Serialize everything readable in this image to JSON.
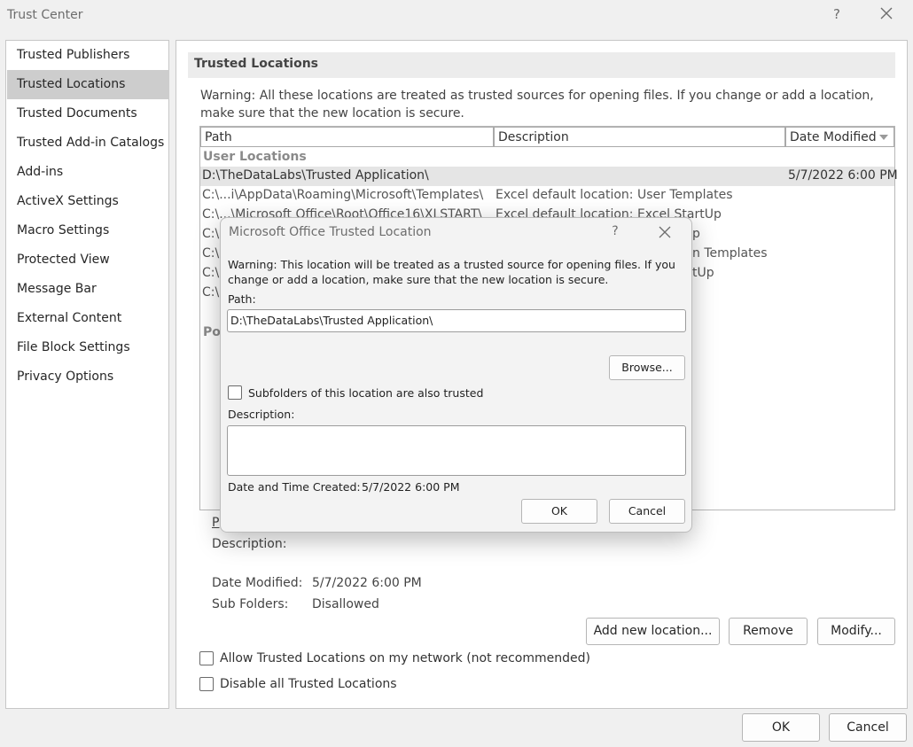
{
  "window": {
    "title": "Trust Center",
    "help": "?",
    "close_icon": "close-icon"
  },
  "sidebar": {
    "items": [
      {
        "label": "Trusted Publishers"
      },
      {
        "label": "Trusted Locations",
        "selected": true
      },
      {
        "label": "Trusted Documents"
      },
      {
        "label": "Trusted Add-in Catalogs"
      },
      {
        "label": "Add-ins"
      },
      {
        "label": "ActiveX Settings"
      },
      {
        "label": "Macro Settings"
      },
      {
        "label": "Protected View"
      },
      {
        "label": "Message Bar"
      },
      {
        "label": "External Content"
      },
      {
        "label": "File Block Settings"
      },
      {
        "label": "Privacy Options"
      }
    ]
  },
  "main": {
    "section_title": "Trusted Locations",
    "warning": "Warning: All these locations are treated as trusted sources for opening files.  If you change or add a location, make sure that the new location is secure.",
    "table": {
      "columns": [
        "Path",
        "Description",
        "Date Modified"
      ],
      "sort_icon": "sort-down-icon",
      "group_user": "User Locations",
      "group_policy_partial": "Po",
      "rows": [
        {
          "path": "D:\\TheDataLabs\\Trusted Application\\",
          "description": "",
          "date": "5/7/2022 6:00 PM",
          "selected": true
        },
        {
          "path": "C:\\...i\\AppData\\Roaming\\Microsoft\\Templates\\",
          "description": "Excel default location: User Templates",
          "date": ""
        },
        {
          "path": "C:\\...\\Microsoft Office\\Root\\Office16\\XLSTART\\",
          "description": "Excel default location: Excel StartUp",
          "date": ""
        },
        {
          "path": "C:\\.",
          "description": "p",
          "date": ""
        },
        {
          "path": "C:\\.",
          "description": "n Templates",
          "date": ""
        },
        {
          "path": "C:\\.",
          "description": "tUp",
          "date": ""
        },
        {
          "path": "C:\\.",
          "description": "",
          "date": ""
        }
      ]
    },
    "details": {
      "path_label_partial": "P",
      "description_label": "Description:",
      "date_modified_label": "Date Modified:",
      "date_modified_value": "5/7/2022 6:00 PM",
      "subfolders_label": "Sub Folders:",
      "subfolders_value": "Disallowed"
    },
    "buttons": {
      "add_new": "Add new location...",
      "remove": "Remove",
      "modify": "Modify..."
    },
    "checkboxes": {
      "allow_network": "Allow Trusted Locations on my network (not recommended)",
      "disable_all": "Disable all Trusted Locations"
    }
  },
  "footer": {
    "ok": "OK",
    "cancel": "Cancel"
  },
  "dialog": {
    "title": "Microsoft Office Trusted Location",
    "help": "?",
    "warning": "Warning: This location will be treated as a trusted source for opening files. If you change or add a location, make sure that the new location is secure.",
    "path_label": "Path:",
    "path_value": "D:\\TheDataLabs\\Trusted Application\\",
    "browse": "Browse...",
    "subfolders_label": "Subfolders of this location are also trusted",
    "subfolders_checked": false,
    "description_label": "Description:",
    "description_value": "",
    "created_label": "Date and Time Created:",
    "created_value": "5/7/2022 6:00 PM",
    "ok": "OK",
    "cancel": "Cancel"
  }
}
